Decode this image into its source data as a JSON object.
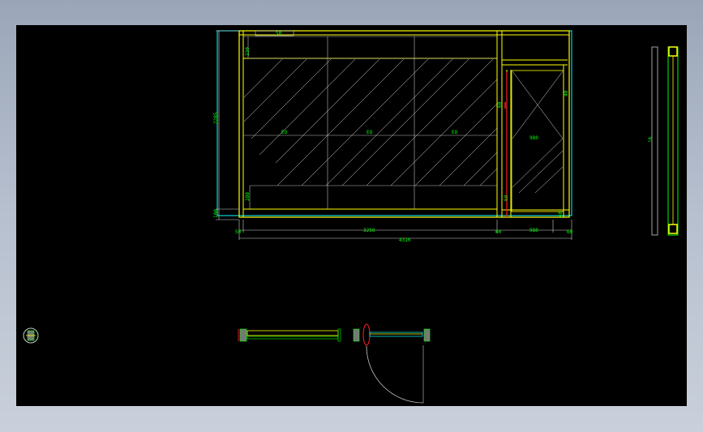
{
  "colors": {
    "background": "#000000",
    "frame": "#ffff00",
    "dimension": "#00ff00",
    "outline": "#00ffff",
    "hatch": "#ffffff",
    "grid": "#c8c8c8",
    "door_edge": "#ff0000"
  },
  "elevation": {
    "height_total": "2285",
    "height_top_panel": "230",
    "height_bottom_panel": "280",
    "height_base": "100",
    "width_total": "4310",
    "width_glass": "3250",
    "width_door": "980",
    "width_left_post": "50",
    "width_mid_post": "60",
    "width_right_post": "60",
    "panel_label_1": "EO",
    "panel_label_2": "EO",
    "panel_label_3": "EO",
    "door_label": "980",
    "door_side_top": "60",
    "door_side_bottom": "60",
    "door_right_top": "40",
    "door_right_bottom": "40",
    "top_dim": "50"
  },
  "section": {
    "label": "16"
  }
}
